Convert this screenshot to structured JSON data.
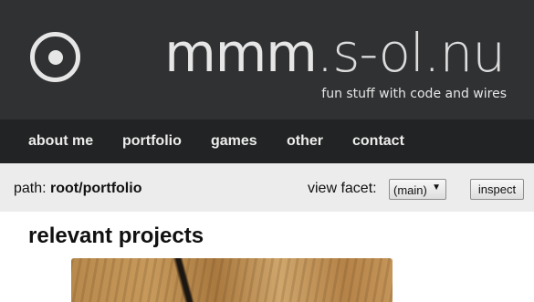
{
  "header": {
    "site_title_main": "mmm",
    "site_title_rest": ".s-ol.nu",
    "tagline": "fun stuff with code and wires",
    "logo_icon": "circle-dot-icon"
  },
  "nav": {
    "items": [
      {
        "label": "about me"
      },
      {
        "label": "portfolio"
      },
      {
        "label": "games"
      },
      {
        "label": "other"
      },
      {
        "label": "contact"
      }
    ]
  },
  "pathbar": {
    "path_prefix": "path: ",
    "path_root": "root",
    "path_sep": "/",
    "path_current": "portfolio",
    "facet_label": "view facet:",
    "facet_value": "(main)",
    "inspect_label": "inspect"
  },
  "main": {
    "section_title": "relevant projects"
  },
  "colors": {
    "header_bg": "#2f3133",
    "nav_bg": "#222324",
    "pathbar_bg": "#ececec",
    "text_light": "#e6e6e6"
  }
}
